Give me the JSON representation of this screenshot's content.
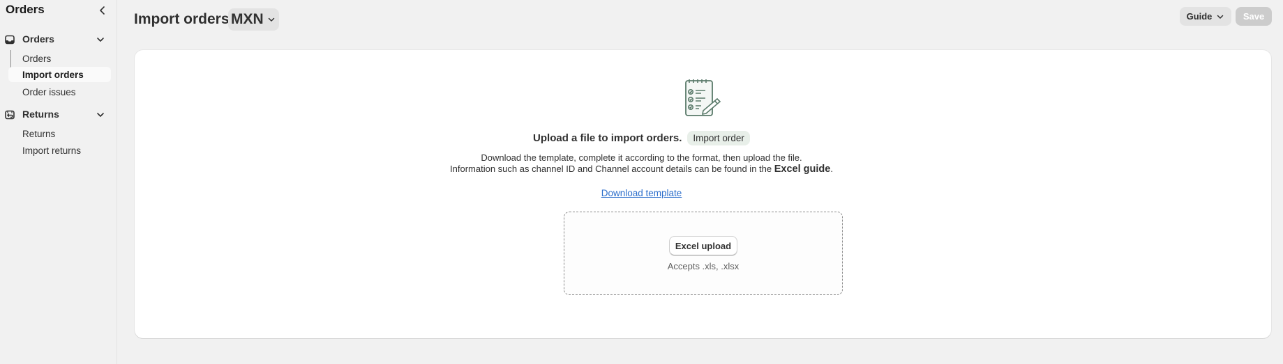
{
  "sidebar": {
    "title": "Orders",
    "sections": [
      {
        "label": "Orders",
        "items": [
          {
            "label": "Orders"
          },
          {
            "label": "Import orders"
          },
          {
            "label": "Order issues"
          }
        ]
      },
      {
        "label": "Returns",
        "items": [
          {
            "label": "Returns"
          },
          {
            "label": "Import returns"
          }
        ]
      }
    ],
    "active_item": "Import orders"
  },
  "header": {
    "title": "Import orders",
    "currency": "MXN",
    "guide_label": "Guide",
    "save_label": "Save"
  },
  "card": {
    "headline": "Upload a file to import orders.",
    "badge": "Import order",
    "desc_line1": "Download the template, complete it according to the format, then upload the file.",
    "desc_line2_prefix": "Information such as channel ID and Channel account details can be found in the ",
    "desc_line2_strong": "Excel guide",
    "desc_line2_suffix": ".",
    "download_link": "Download template",
    "upload_button": "Excel upload",
    "accepts": "Accepts .xls, .xlsx"
  },
  "colors": {
    "link": "#2c6ecb",
    "save_disabled": "#cccccc",
    "badge_bg": "#e8efe9",
    "illustration_stroke": "#5a7a6a"
  }
}
